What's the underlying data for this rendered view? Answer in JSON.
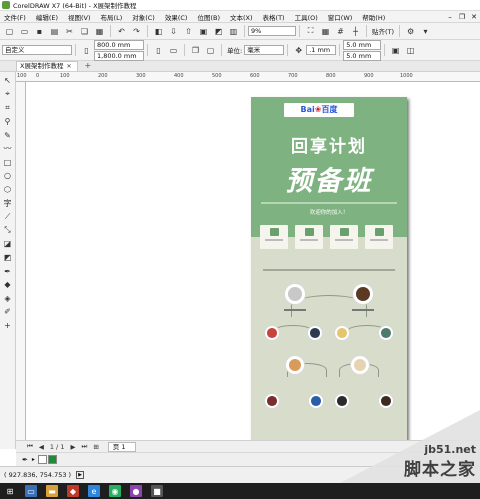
{
  "window": {
    "title": "CorelDRAW X7 (64-Bit) - X展架制作教程"
  },
  "menu": {
    "items": [
      "文件(F)",
      "编辑(E)",
      "视图(V)",
      "布局(L)",
      "对象(C)",
      "效果(C)",
      "位图(B)",
      "文本(X)",
      "表格(T)",
      "工具(O)",
      "窗口(W)",
      "帮助(H)"
    ]
  },
  "toolbar1": {
    "zoom": "9%",
    "snap_label": "贴齐(T)"
  },
  "toolbar2": {
    "preset": "自定义",
    "width": "800.0 mm",
    "height": "1,800.0 mm",
    "units_label": "单位:",
    "units": "毫米",
    "nudge": ".1 mm",
    "dup_x": "5.0 mm",
    "dup_y": "5.0 mm"
  },
  "document": {
    "tab_label": "X展架制作教程"
  },
  "ruler": {
    "ticks": [
      "100",
      "0",
      "100",
      "200",
      "300",
      "400",
      "500",
      "600",
      "700",
      "800",
      "900",
      "1000"
    ]
  },
  "poster": {
    "logo_text": "Bai",
    "logo_suffix": "百度",
    "headline1": "回享计划",
    "headline2": "预备班",
    "joinus": "欢迎你的加入！"
  },
  "pagebar": {
    "page_count": "1 / 1",
    "page_tab": "页 1"
  },
  "status": {
    "coordinates": "( 927.836, 754.753 )"
  },
  "watermark": {
    "site": "jb51.net",
    "brand": "脚本之家"
  },
  "colors": {
    "poster_green": "#7fb281",
    "poster_bg": "#d7dccb",
    "accent_green": "#5a9e3a"
  }
}
